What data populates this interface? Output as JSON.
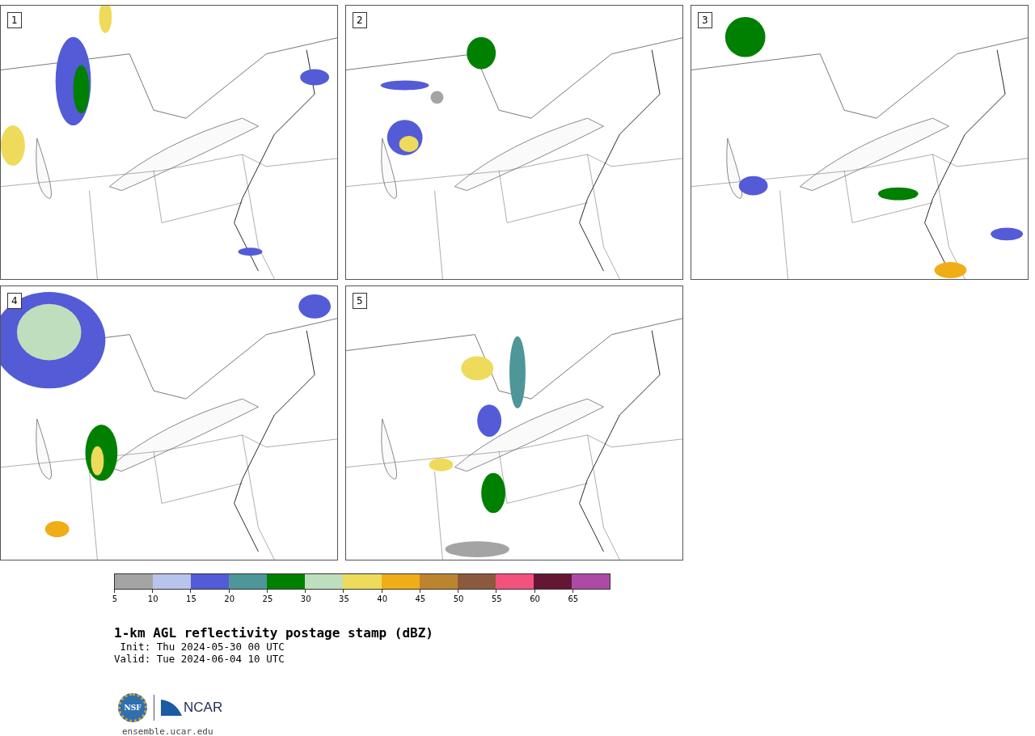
{
  "panels": [
    {
      "label": "1"
    },
    {
      "label": "2"
    },
    {
      "label": "3"
    },
    {
      "label": "4"
    },
    {
      "label": "5"
    }
  ],
  "colorbar": {
    "segments": [
      {
        "color": "#a4a4a4"
      },
      {
        "color": "#b8c4ec"
      },
      {
        "color": "#535bd6"
      },
      {
        "color": "#4f9698"
      },
      {
        "color": "#008000"
      },
      {
        "color": "#bedfbe"
      },
      {
        "color": "#eedb5b"
      },
      {
        "color": "#efad17"
      },
      {
        "color": "#bd842f"
      },
      {
        "color": "#8b5a3e"
      },
      {
        "color": "#f2527e"
      },
      {
        "color": "#631735"
      },
      {
        "color": "#ad4aa6"
      }
    ],
    "ticks": [
      "5",
      "10",
      "15",
      "20",
      "25",
      "30",
      "35",
      "40",
      "45",
      "50",
      "55",
      "60",
      "65"
    ]
  },
  "title": "1-km AGL reflectivity postage stamp (dBZ)",
  "init": " Init: Thu 2024-05-30 00 UTC",
  "valid": "Valid: Tue 2024-06-04 10 UTC",
  "logo": {
    "nsf": "NSF",
    "ncar": "NCAR"
  },
  "footer": "ensemble.ucar.edu"
}
